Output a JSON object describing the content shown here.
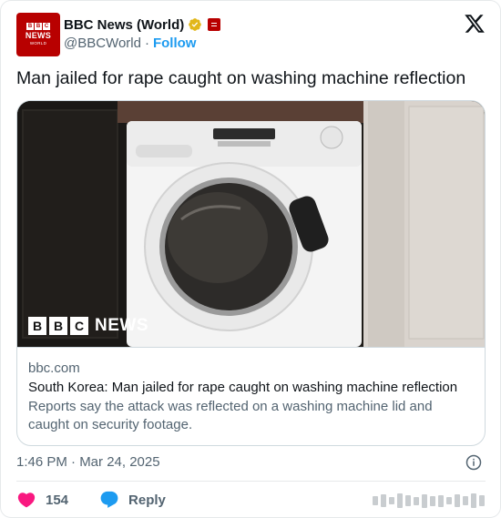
{
  "author": {
    "display_name": "BBC News (World)",
    "handle": "@BBCWorld",
    "separator": "·",
    "follow_label": "Follow",
    "avatar": {
      "letters": [
        "B",
        "B",
        "C"
      ],
      "word": "NEWS",
      "sub": "WORLD"
    }
  },
  "tweet": {
    "text": "Man jailed for rape caught on washing machine reflection",
    "timestamp": "1:46 PM · Mar 24, 2025"
  },
  "card": {
    "media_logo": {
      "letters": [
        "B",
        "B",
        "C"
      ],
      "word": "NEWS"
    },
    "domain": "bbc.com",
    "title": "South Korea: Man jailed for rape caught on washing machine reflection",
    "description": "Reports say the attack was reflected on a washing machine lid and caught on security footage."
  },
  "actions": {
    "likes_count": "154",
    "reply_label": "Reply"
  },
  "colors": {
    "accent": "#1d9bf0",
    "like": "#f91880",
    "bbc_red": "#b80000",
    "verified_gold": "#e2b719",
    "secondary_text": "#536471"
  },
  "icons": [
    "verified-gold-badge-icon",
    "affiliate-badge-icon",
    "x-logo-icon",
    "info-icon",
    "heart-icon",
    "reply-bubble-icon"
  ]
}
